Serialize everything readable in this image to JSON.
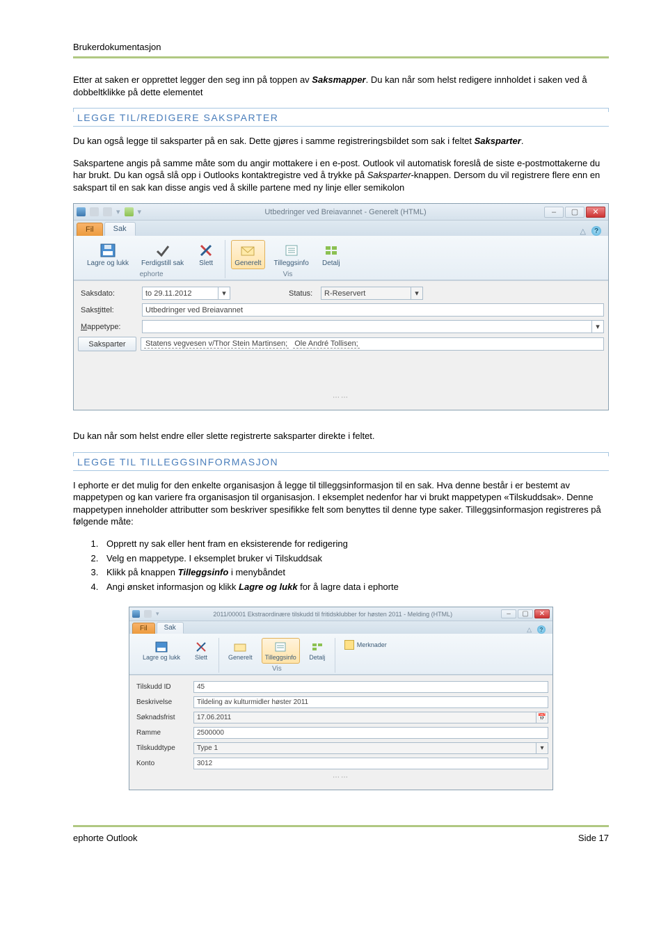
{
  "doc": {
    "header": "Brukerdokumentasjon",
    "footer_left": "ephorte Outlook",
    "footer_right": "Side 17"
  },
  "intro": {
    "p1a": "Etter at saken er opprettet legger den seg inn på toppen av ",
    "p1b": "Saksmapper",
    "p1c": ". Du kan når som helst redigere innholdet i saken ved å dobbeltklikke på dette elementet"
  },
  "section1": {
    "heading": "LEGGE TIL/REDIGERE SAKSPARTER",
    "p1a": "Du kan også legge til saksparter på en sak. Dette gjøres i samme registreringsbildet som sak i feltet ",
    "p1b": "Saksparter",
    "p1c": ".",
    "p2a": "Sakspartene angis på samme måte som du angir mottakere i en e-post. Outlook vil automatisk foreslå de siste e-postmottakerne du har brukt. Du kan også slå opp i Outlooks kontaktregistre ved å trykke på ",
    "p2b": "Saksparter",
    "p2c": "-knappen. Dersom du vil registrere flere enn en sakspart til en sak kan disse angis ved å skille partene med ny linje eller semikolon",
    "after_img": "Du kan når som helst endre eller slette registrerte saksparter direkte i feltet."
  },
  "section2": {
    "heading": "LEGGE TIL TILLEGGSINFORMASJON",
    "p1": "I ephorte er det mulig for den enkelte organisasjon å legge til tilleggsinformasjon til en sak. Hva denne består i er bestemt av mappetypen og kan variere fra organisasjon til organisasjon. I eksemplet nedenfor har vi brukt mappetypen «Tilskuddsak». Denne mappetypen inneholder attributter som beskriver spesifikke felt som benyttes til denne type saker. Tilleggsinformasjon registreres på følgende måte:",
    "steps": [
      "Opprett ny sak eller hent fram en eksisterende for redigering",
      "Velg en mappetype. I eksemplet bruker vi Tilskuddsak",
      "Klikk på knappen <b><i>Tilleggsinfo</i></b> i menybåndet",
      "Angi ønsket informasjon og klikk <b><i>Lagre og lukk</i></b> for å lagre data i ephorte"
    ]
  },
  "win1": {
    "title": "Utbedringer ved Breiavannet  -  Generelt (HTML)",
    "tabs": {
      "fil": "Fil",
      "sak": "Sak"
    },
    "ribbon": {
      "group1_label": "ephorte",
      "group2_label": "Vis",
      "lagre": "Lagre og lukk",
      "ferdigstill": "Ferdigstill sak",
      "slett": "Slett",
      "generelt": "Generelt",
      "tilleggsinfo": "Tilleggsinfo",
      "detalj": "Detalj"
    },
    "form": {
      "saksdato_label": "Saksdato:",
      "saksdato_value": "to 29.11.2012",
      "status_label": "Status:",
      "status_value": "R-Reservert",
      "sakstittel_label": "Sakstittel:",
      "sakstittel_value": "Utbedringer ved Breiavannet",
      "mappetype_label": "Mappetype:",
      "saksparter_btn": "Saksparter",
      "chip1": "Statens vegvesen v/Thor Stein Martinsen;",
      "chip2": "Ole André Tollisen;"
    }
  },
  "win2": {
    "title": "2011/00001 Ekstraordinære tilskudd til fritidsklubber for høsten 2011  -  Melding (HTML)",
    "tabs": {
      "fil": "Fil",
      "sak": "Sak"
    },
    "ribbon": {
      "group1_label": "",
      "group2_label": "Vis",
      "lagre": "Lagre og lukk",
      "slett": "Slett",
      "generelt": "Generelt",
      "tilleggsinfo": "Tilleggsinfo",
      "detalj": "Detalj",
      "merknader": "Merknader"
    },
    "form": {
      "tilskudd_id_label": "Tilskudd ID",
      "tilskudd_id_value": "45",
      "beskrivelse_label": "Beskrivelse",
      "beskrivelse_value": "Tildeling av kulturmidler høster 2011",
      "soknadsfrist_label": "Søknadsfrist",
      "soknadsfrist_value": "17.06.2011",
      "ramme_label": "Ramme",
      "ramme_value": "2500000",
      "tilskuddtype_label": "Tilskuddtype",
      "tilskuddtype_value": "Type 1",
      "konto_label": "Konto",
      "konto_value": "3012"
    }
  }
}
